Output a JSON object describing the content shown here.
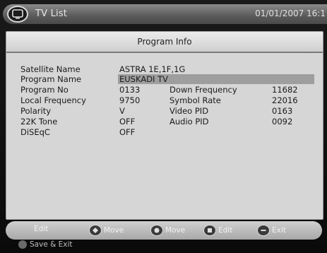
{
  "topbar": {
    "icon": "tv-icon",
    "title": "TV List",
    "datetime": "01/01/2007 16:1"
  },
  "panel": {
    "title": "Program Info",
    "rows": [
      {
        "label": "Satellite Name",
        "value": "ASTRA 1E,1F,1G",
        "label2": "",
        "value2": ""
      },
      {
        "label": "Program Name",
        "value": "EUSKADI TV",
        "label2": "",
        "value2": ""
      },
      {
        "label": "Program No",
        "value": "0133",
        "label2": "Down Frequency",
        "value2": "11682"
      },
      {
        "label": "Local Frequency",
        "value": "9750",
        "label2": "Symbol Rate",
        "value2": "22016"
      },
      {
        "label": "Polarity",
        "value": "V",
        "label2": "Video PID",
        "value2": "0163"
      },
      {
        "label": "22K Tone",
        "value": "OFF",
        "label2": "Audio PID",
        "value2": "0092"
      },
      {
        "label": "DiSEqC",
        "value": "OFF",
        "label2": "",
        "value2": ""
      }
    ]
  },
  "bottombar": {
    "edit": "Edit",
    "move1": "Move",
    "move2": "Move",
    "edit2": "Edit",
    "exit": "Exit"
  },
  "footer": {
    "save_exit": "Save & Exit"
  }
}
